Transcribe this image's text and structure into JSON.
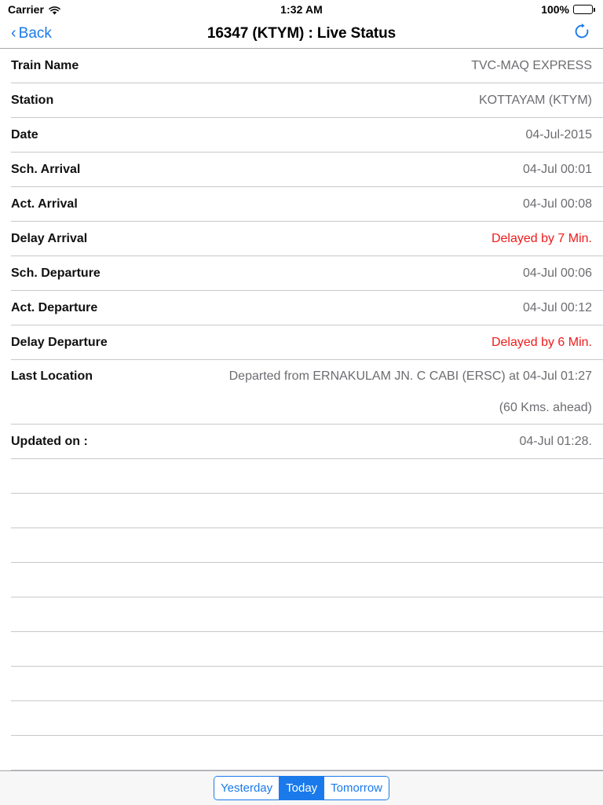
{
  "status_bar": {
    "carrier": "Carrier",
    "wifi_icon": "wifi-icon",
    "time": "1:32 AM",
    "battery_percent": "100%",
    "battery_icon": "battery-full-icon"
  },
  "nav": {
    "back_label": "Back",
    "back_chevron": "‹",
    "title": "16347 (KTYM) : Live Status",
    "refresh_icon": "refresh-icon",
    "accent_color": "#1a7aeb"
  },
  "colors": {
    "accent": "#1a7aeb",
    "delay_red": "#ee1b1b",
    "value_gray": "#6d6d72",
    "separator": "#c8c7cc",
    "toolbar_bg": "#f7f7f7"
  },
  "table": {
    "rows": [
      {
        "label": "Train Name",
        "value": "TVC-MAQ EXPRESS"
      },
      {
        "label": "Station",
        "value": "KOTTAYAM (KTYM)"
      },
      {
        "label": "Date",
        "value": "04-Jul-2015"
      },
      {
        "label": "Sch. Arrival",
        "value": "04-Jul 00:01"
      },
      {
        "label": "Act. Arrival",
        "value": "04-Jul 00:08"
      },
      {
        "label": "Delay Arrival",
        "value": "Delayed by 7 Min."
      },
      {
        "label": "Sch. Departure",
        "value": "04-Jul 00:06"
      },
      {
        "label": "Act. Departure",
        "value": "04-Jul 00:12"
      },
      {
        "label": "Delay Departure",
        "value": "Delayed by 6 Min."
      }
    ],
    "last_location": {
      "label": "Last Location",
      "line1": "Departed from ERNAKULAM JN. C CABI (ERSC) at 04-Jul 01:27",
      "line2": "(60 Kms. ahead)"
    },
    "updated_on": {
      "label": "Updated on :",
      "value": "04-Jul 01:28."
    },
    "empty_row_count": 9
  },
  "toolbar": {
    "segments": [
      {
        "label": "Yesterday",
        "selected": false
      },
      {
        "label": "Today",
        "selected": true
      },
      {
        "label": "Tomorrow",
        "selected": false
      }
    ]
  }
}
